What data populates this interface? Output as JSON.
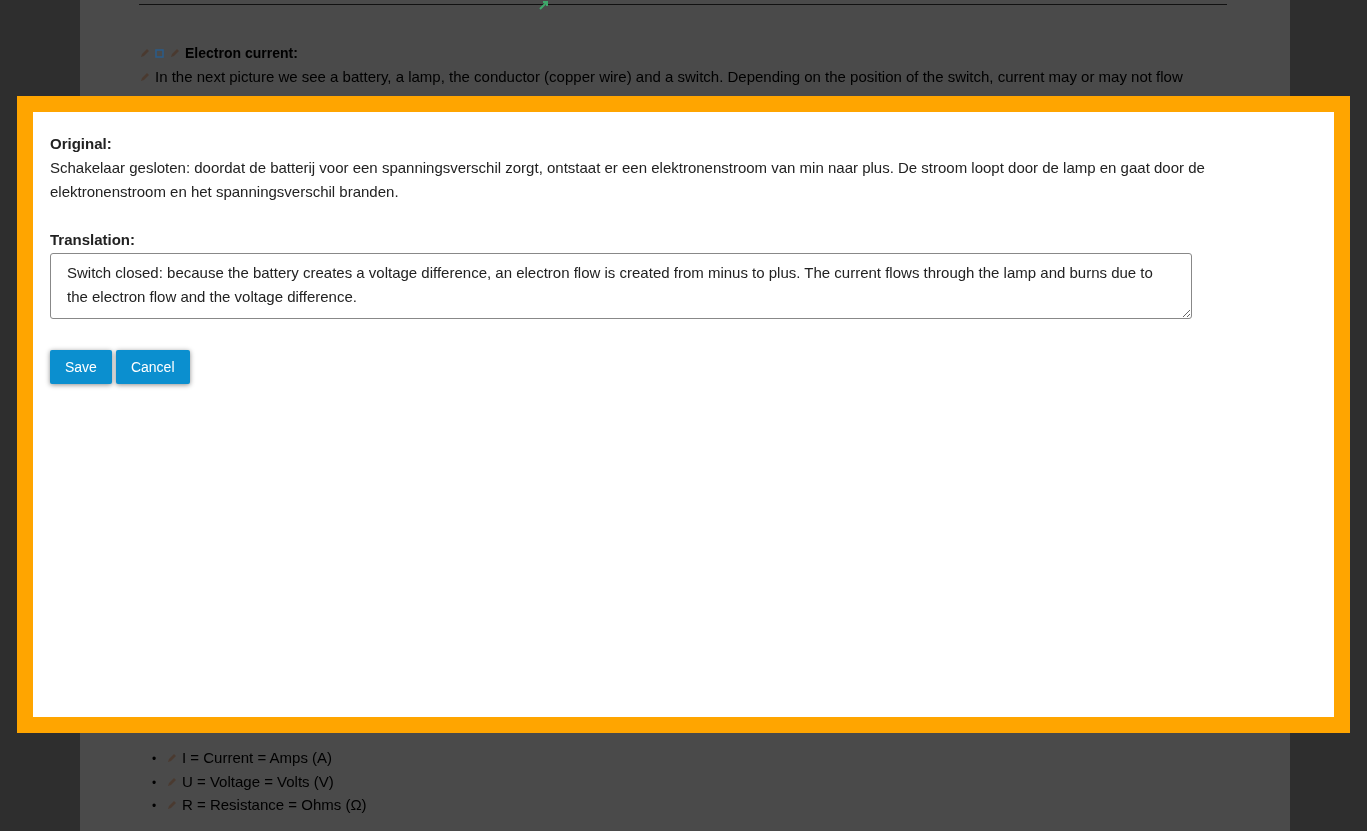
{
  "background": {
    "heading": "Electron current:",
    "paragraph": "In the next picture we see a battery, a lamp, the conductor (copper wire) and a switch. Depending on the position of the switch, current may or may not flow",
    "list": [
      {
        "marker": "•",
        "text": "I = Current = Amps (A)"
      },
      {
        "marker": "•",
        "text": "U = Voltage = Volts (V)"
      },
      {
        "marker": "•",
        "text": "R = Resistance = Ohms (Ω)"
      }
    ]
  },
  "dialog": {
    "original_label": "Original:",
    "original_text": "Schakelaar gesloten: doordat de batterij voor een spanningsverschil zorgt, ontstaat er een elektronenstroom van min naar plus. De stroom loopt door de lamp en gaat door de elektronenstroom en het spanningsverschil branden.",
    "translation_label": "Translation:",
    "translation_value": "Switch closed: because the battery creates a voltage difference, an electron flow is created from minus to plus. The current flows through the lamp and burns due to the electron flow and the voltage difference.",
    "buttons": [
      {
        "label": "Save"
      },
      {
        "label": "Cancel"
      }
    ]
  }
}
